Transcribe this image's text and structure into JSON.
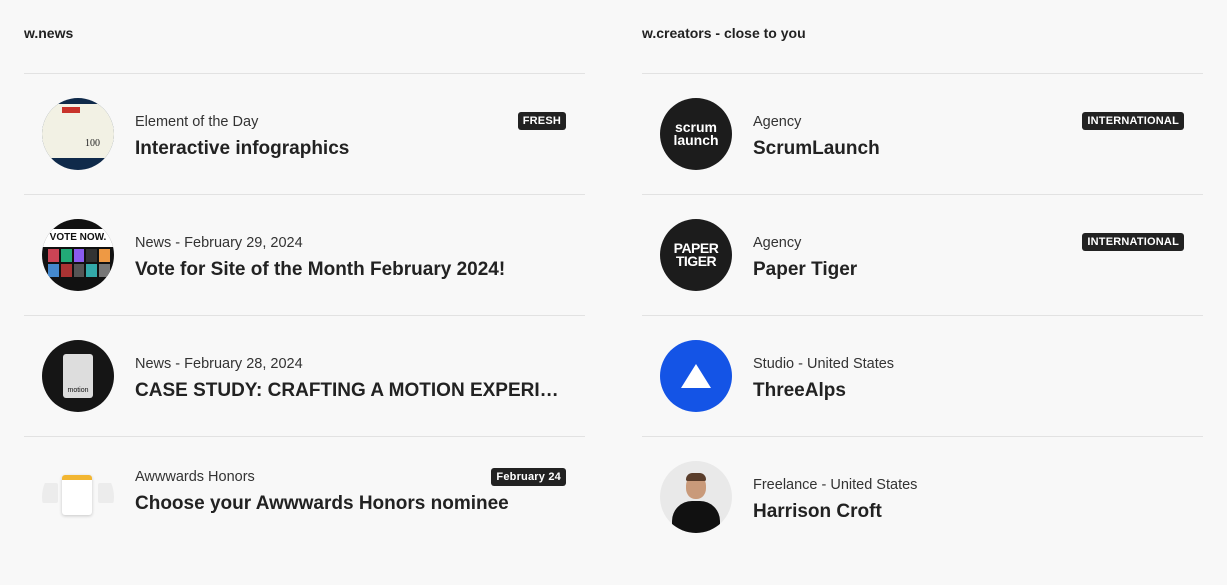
{
  "news": {
    "heading": "w.news",
    "items": [
      {
        "meta": "Element of the Day",
        "title": "Interactive infographics",
        "badge": "FRESH",
        "thumb": "infographic-thumbnail",
        "thumb_text": "100"
      },
      {
        "meta": "News - February 29, 2024",
        "title": "Vote for Site of the Month February 2024!",
        "thumb": "vote-now-thumbnail",
        "thumb_text": "VOTE NOW."
      },
      {
        "meta": "News - February 28, 2024",
        "title": "CASE STUDY: CRAFTING A MOTION EXPERIENCE",
        "thumb": "motion-book-thumbnail",
        "thumb_text": "motion"
      },
      {
        "meta": "Awwwards Honors",
        "title": "Choose your Awwwards Honors nominee",
        "badge": "February 24",
        "thumb": "honors-card-thumbnail"
      }
    ]
  },
  "creators": {
    "heading": "w.creators - close to you",
    "items": [
      {
        "meta": "Agency",
        "title": "ScrumLaunch",
        "badge": "INTERNATIONAL",
        "logo_text": "scrum launch"
      },
      {
        "meta": "Agency",
        "title": "Paper Tiger",
        "badge": "INTERNATIONAL",
        "logo_text": "PAPER TIGER"
      },
      {
        "meta": "Studio - United States",
        "title": "ThreeAlps"
      },
      {
        "meta": "Freelance - United States",
        "title": "Harrison Croft"
      }
    ]
  },
  "colors": {
    "background": "#f8f8f8",
    "text": "#222222",
    "badge": "#222222",
    "threealps_blue": "#1454e6"
  }
}
